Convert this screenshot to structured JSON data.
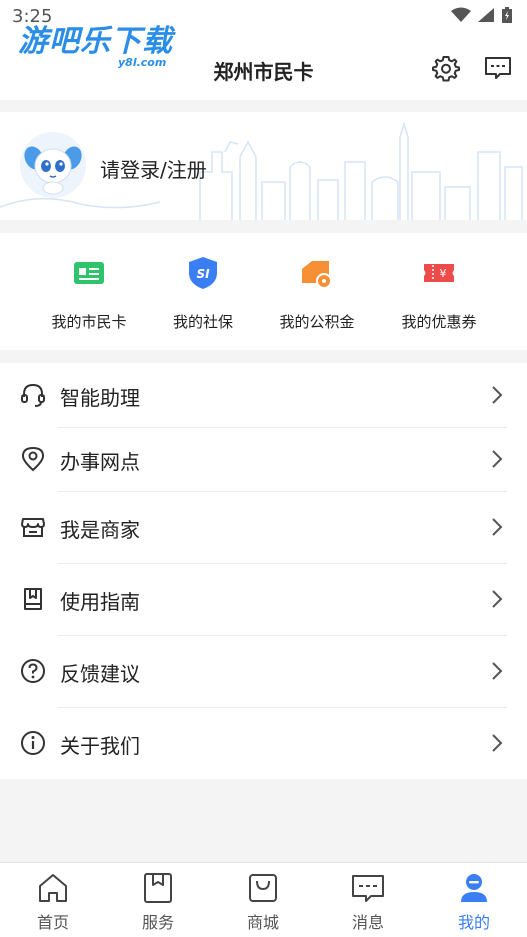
{
  "status_bar": {
    "time": "3:25"
  },
  "watermark": {
    "logo_text": "游吧乐下载",
    "logo_sub": "y8l.com"
  },
  "header": {
    "title": "郑州市民卡",
    "icons": [
      "settings-icon",
      "message-icon"
    ]
  },
  "profile": {
    "login_text": "请登录/注册"
  },
  "quick_actions": [
    {
      "label": "我的市民卡",
      "icon": "card-icon",
      "color": "#2fc36a"
    },
    {
      "label": "我的社保",
      "icon": "social-security-icon",
      "color": "#3a7ef4"
    },
    {
      "label": "我的公积金",
      "icon": "fund-icon",
      "color": "#f78f34"
    },
    {
      "label": "我的优惠券",
      "icon": "coupon-icon",
      "color": "#ee4b4b"
    }
  ],
  "menu": [
    {
      "label": "智能助理",
      "icon": "headset-icon"
    },
    {
      "label": "办事网点",
      "icon": "location-pin-icon"
    },
    {
      "label": "我是商家",
      "icon": "store-icon"
    },
    {
      "label": "使用指南",
      "icon": "book-icon"
    },
    {
      "label": "反馈建议",
      "icon": "question-icon"
    },
    {
      "label": "关于我们",
      "icon": "info-icon"
    }
  ],
  "tabbar": {
    "active": "我的",
    "accent_color": "#3a7ef4",
    "tabs": [
      {
        "label": "首页",
        "icon": "home-icon"
      },
      {
        "label": "服务",
        "icon": "bookmark-icon"
      },
      {
        "label": "商城",
        "icon": "shopping-bag-icon"
      },
      {
        "label": "消息",
        "icon": "message-icon"
      },
      {
        "label": "我的",
        "icon": "user-icon"
      }
    ]
  }
}
